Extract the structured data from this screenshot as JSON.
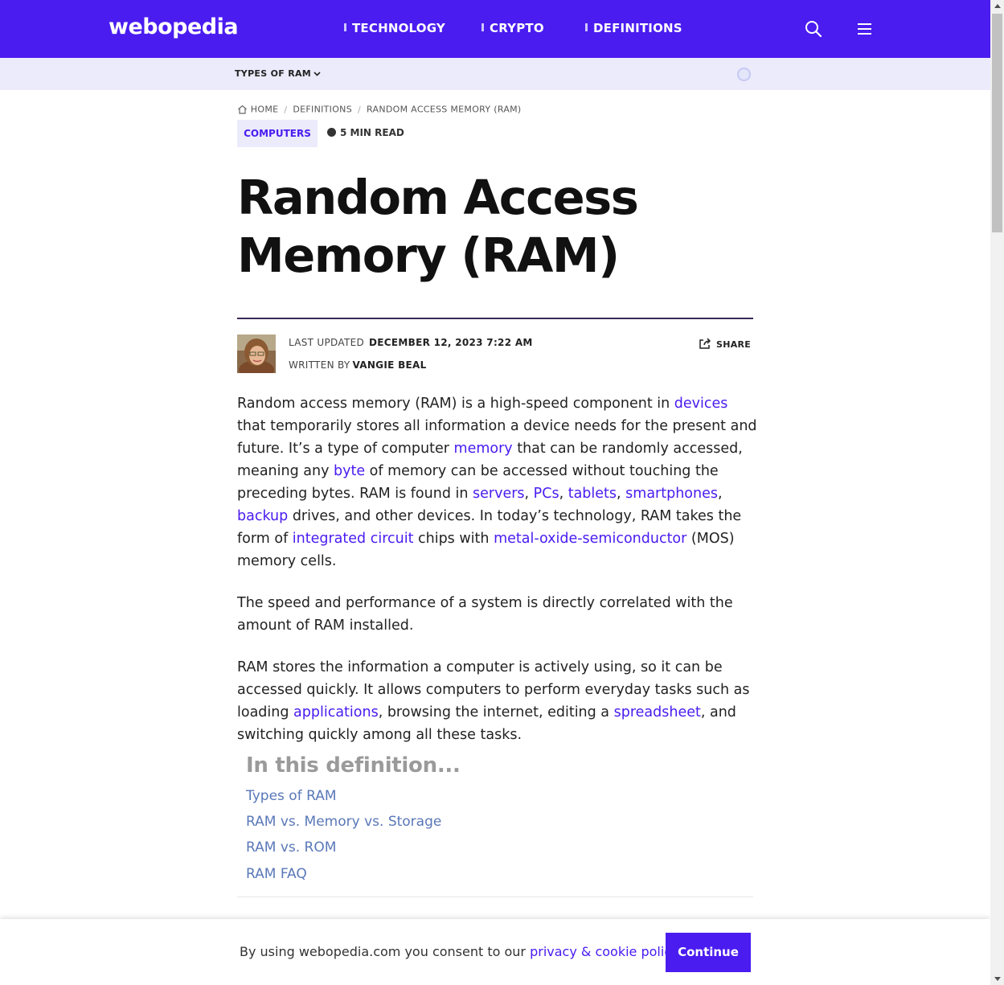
{
  "header": {
    "logo": "webopedia",
    "nav": [
      "TECHNOLOGY",
      "CRYPTO",
      "DEFINITIONS"
    ],
    "search_icon": "search-icon",
    "menu_icon": "hamburger-menu-icon",
    "brand_color": "#4a1cf0"
  },
  "subbar": {
    "dropdown_label": "TYPES OF RAM",
    "dropdown_icon": "chevron-down-icon"
  },
  "breadcrumb": [
    "HOME",
    "DEFINITIONS",
    "RANDOM ACCESS MEMORY (RAM)"
  ],
  "category_badge": "COMPUTERS",
  "read_time": "5 MIN READ",
  "title_line1": "Random Access",
  "title_line2": "Memory (RAM)",
  "meta": {
    "last_updated_label": "LAST UPDATED",
    "last_updated_value": "DECEMBER 12, 2023 7:22 AM",
    "written_by_label": "WRITTEN BY",
    "author": "VANGIE BEAL",
    "share_label": "SHARE"
  },
  "article": {
    "p1": [
      {
        "t": "Random access memory (RAM) is a high-speed component in "
      },
      {
        "l": "devices"
      },
      {
        "t": " that temporarily stores all information a device needs for the present and future. It’s a type of computer "
      },
      {
        "l": "memory"
      },
      {
        "t": " that can be randomly accessed, meaning any "
      },
      {
        "l": "byte"
      },
      {
        "t": " of memory can be accessed without touching the preceding bytes. RAM is found in "
      },
      {
        "l": "servers"
      },
      {
        "t": ", "
      },
      {
        "l": "PCs"
      },
      {
        "t": ", "
      },
      {
        "l": "tablets"
      },
      {
        "t": ", "
      },
      {
        "l": "smartphones"
      },
      {
        "t": ", "
      },
      {
        "l": "backup"
      },
      {
        "t": " drives, and other devices. In today’s technology, RAM takes the form of "
      },
      {
        "l": "integrated circuit"
      },
      {
        "t": " chips with "
      },
      {
        "l": "metal-oxide-semiconductor"
      },
      {
        "t": " (MOS) memory cells."
      }
    ],
    "p2": [
      {
        "t": "The speed and performance of a system is directly correlated with the amount of RAM installed."
      }
    ],
    "p3": [
      {
        "t": "RAM stores the information a computer is actively using, so it can be accessed quickly. It allows computers to perform everyday tasks such as loading "
      },
      {
        "l": "applications"
      },
      {
        "t": ", browsing the internet, editing a "
      },
      {
        "l": "spreadsheet"
      },
      {
        "t": ", and switching quickly among all these tasks."
      }
    ]
  },
  "toc": {
    "title": "In this definition...",
    "items": [
      "Types of RAM",
      "RAM vs. Memory vs. Storage",
      "RAM vs. ROM",
      "RAM FAQ"
    ]
  },
  "cookie": {
    "text": "By using webopedia.com you consent to our ",
    "link": "privacy & cookie policy",
    "suffix": ".",
    "button": "Continue"
  }
}
